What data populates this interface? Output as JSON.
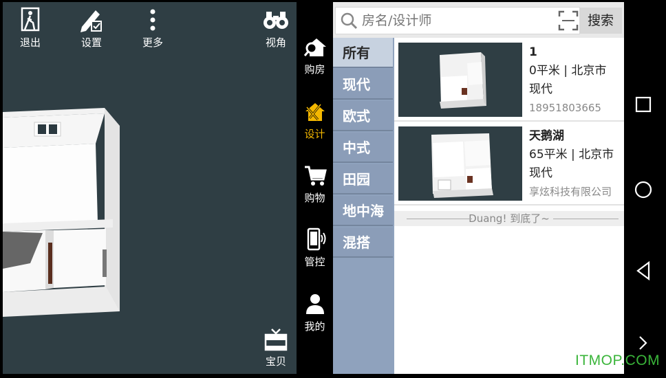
{
  "toolbar": {
    "exit_label": "退出",
    "settings_label": "设置",
    "more_label": "更多",
    "view_label": "视角",
    "treasure_label": "宝贝"
  },
  "sidenav": {
    "items": [
      {
        "label": "购房",
        "icon": "house-search-icon"
      },
      {
        "label": "设计",
        "icon": "design-tools-icon",
        "active": true
      },
      {
        "label": "购物",
        "icon": "shopping-cart-icon"
      },
      {
        "label": "管控",
        "icon": "phone-control-icon"
      },
      {
        "label": "我的",
        "icon": "person-icon"
      }
    ],
    "active_color": "#f5b800"
  },
  "search": {
    "placeholder": "房名/设计师",
    "button_label": "搜索"
  },
  "categories": {
    "items": [
      "所有",
      "现代",
      "欧式",
      "中式",
      "田园",
      "地中海",
      "混搭"
    ],
    "selected": "所有"
  },
  "listings": [
    {
      "name": "1",
      "area_city": "0平米 | 北京市",
      "style": "现代",
      "contact": "18951803665"
    },
    {
      "name": "天鹅湖",
      "area_city": "65平米 | 北京市",
      "style": "现代",
      "contact": "享炫科技有限公司"
    }
  ],
  "list_end_text": "Duang! 到底了~",
  "watermark": "ITMOP.COM"
}
